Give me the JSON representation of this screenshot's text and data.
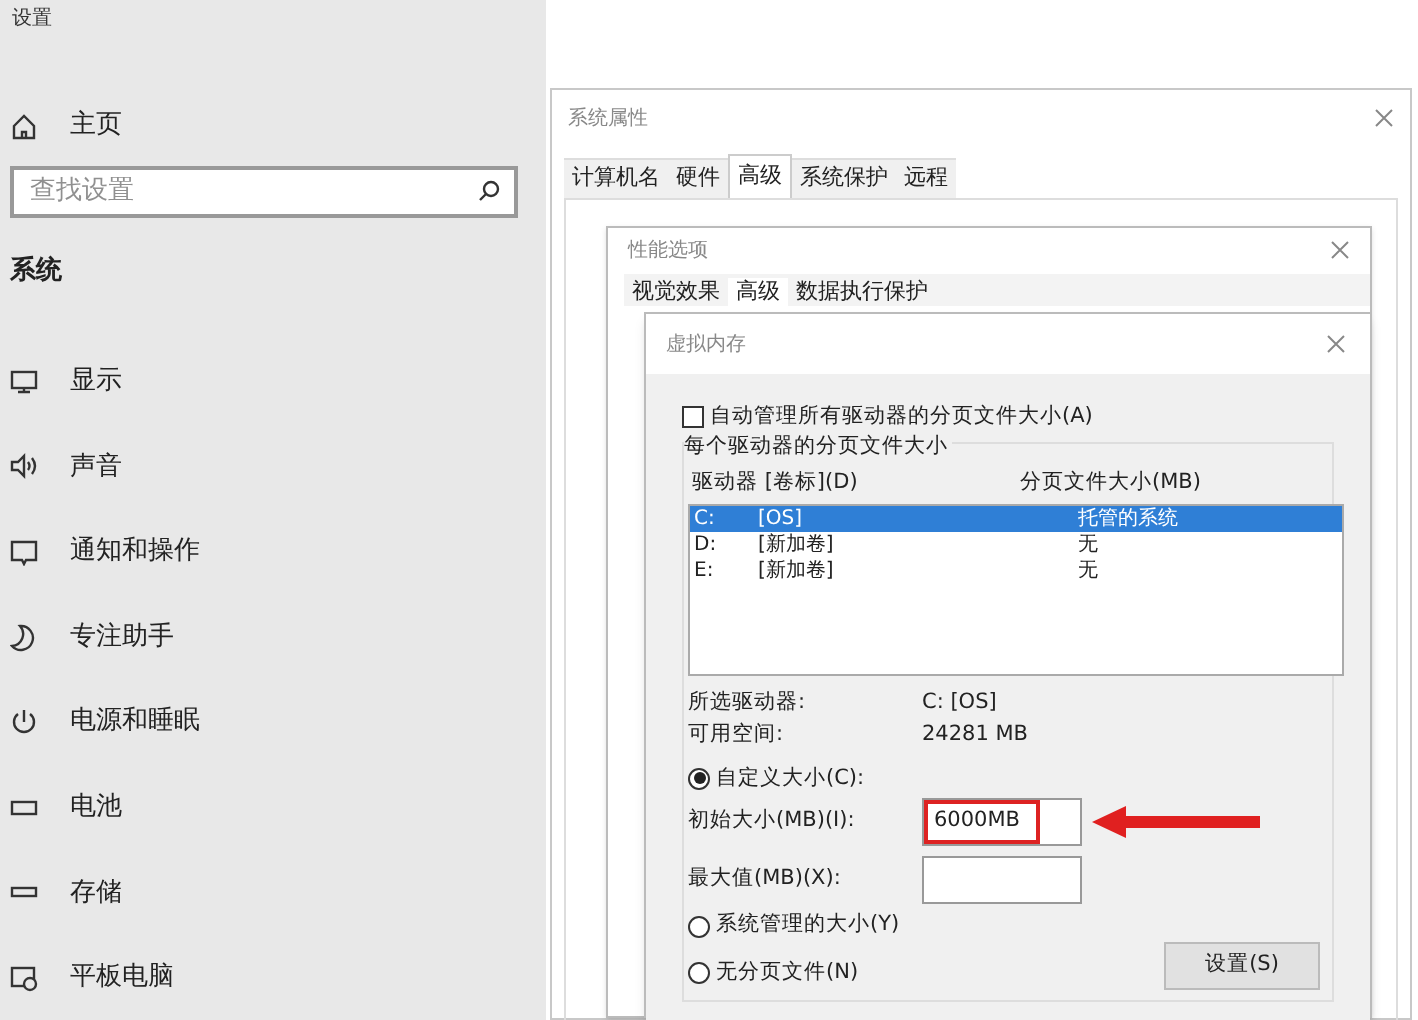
{
  "app": {
    "title": "设置"
  },
  "sidebar": {
    "home": "主页",
    "search": {
      "placeholder": "查找设置"
    },
    "section": "系统",
    "items": [
      {
        "label": "显示",
        "kind": "display"
      },
      {
        "label": "声音",
        "kind": "sound"
      },
      {
        "label": "通知和操作",
        "kind": "notification"
      },
      {
        "label": "专注助手",
        "kind": "moon"
      },
      {
        "label": "电源和睡眠",
        "kind": "power"
      },
      {
        "label": "电池",
        "kind": "battery"
      },
      {
        "label": "存储",
        "kind": "storage"
      },
      {
        "label": "平板电脑",
        "kind": "tablet"
      }
    ]
  },
  "system_properties": {
    "title": "系统属性",
    "tabs": [
      {
        "label": "计算机名",
        "selected": false
      },
      {
        "label": "硬件",
        "selected": false
      },
      {
        "label": "高级",
        "selected": true
      },
      {
        "label": "系统保护",
        "selected": false
      },
      {
        "label": "远程",
        "selected": false
      }
    ]
  },
  "performance_options": {
    "title": "性能选项",
    "tabs": [
      {
        "label": "视觉效果",
        "selected": false
      },
      {
        "label": "高级",
        "selected": true
      },
      {
        "label": "数据执行保护",
        "selected": false
      }
    ]
  },
  "virtual_memory": {
    "title": "虚拟内存",
    "auto_manage": {
      "label": "自动管理所有驱动器的分页文件大小(A)",
      "checked": false
    },
    "group_title": "每个驱动器的分页文件大小",
    "columns": [
      "驱动器 [卷标](D)",
      "分页文件大小(MB)"
    ],
    "drives": [
      {
        "drive": "C:",
        "volume": "[OS]",
        "size": "托管的系统",
        "selected": true
      },
      {
        "drive": "D:",
        "volume": "[新加卷]",
        "size": "无",
        "selected": false
      },
      {
        "drive": "E:",
        "volume": "[新加卷]",
        "size": "无",
        "selected": false
      }
    ],
    "selected_drive": {
      "label": "所选驱动器:",
      "value": "C:  [OS]"
    },
    "free_space": {
      "label": "可用空间:",
      "value": "24281 MB"
    },
    "size_options": [
      {
        "label": "自定义大小(C):",
        "selected": true
      },
      {
        "label": "系统管理的大小(Y)",
        "selected": false
      },
      {
        "label": "无分页文件(N)",
        "selected": false
      }
    ],
    "initial_size": {
      "label": "初始大小(MB)(I):",
      "value": "6000MB",
      "highlighted": true
    },
    "maximum_size": {
      "label": "最大值(MB)(X):"
    },
    "set_button": "设置(S)"
  }
}
